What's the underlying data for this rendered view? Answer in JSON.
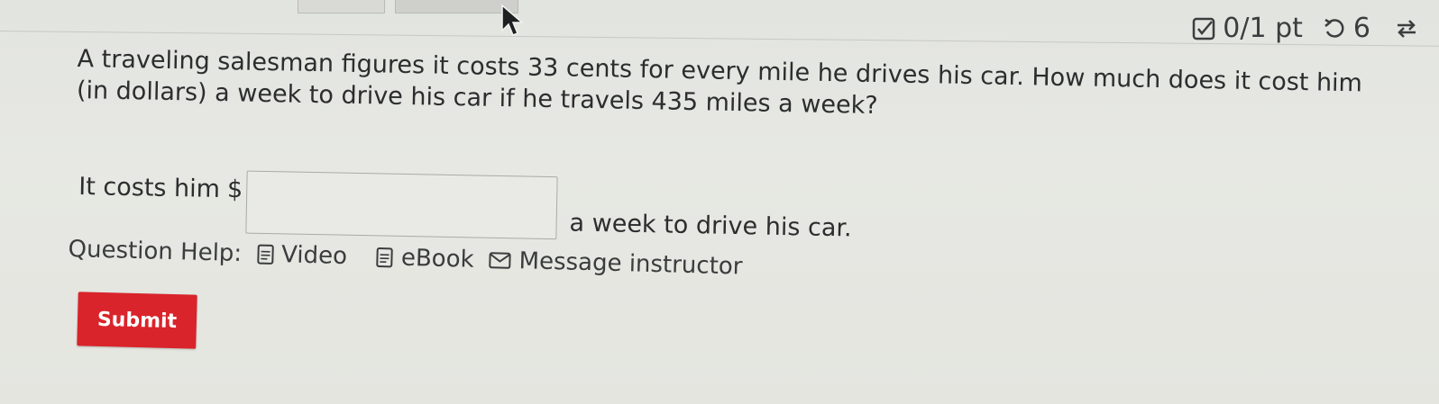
{
  "score": {
    "points": "0/1 pt",
    "attempts": "6"
  },
  "question": {
    "text": "A traveling salesman figures it costs 33 cents for every mile he drives his car. How much does it cost him (in dollars) a week to drive his car if he travels 435 miles a week?"
  },
  "answer": {
    "prefix": "It costs him",
    "currency": "$",
    "value": "",
    "suffix": "a week to drive his car."
  },
  "help": {
    "label": "Question Help:",
    "links": [
      {
        "label": "Video",
        "icon": "document-icon"
      },
      {
        "label": "eBook",
        "icon": "document-icon"
      },
      {
        "label": "Message instructor",
        "icon": "envelope-icon"
      }
    ]
  },
  "submit": {
    "label": "Submit"
  },
  "colors": {
    "submit_bg": "#d9242b",
    "page_bg": "#e6e7e2",
    "text": "#2c2d2e"
  }
}
